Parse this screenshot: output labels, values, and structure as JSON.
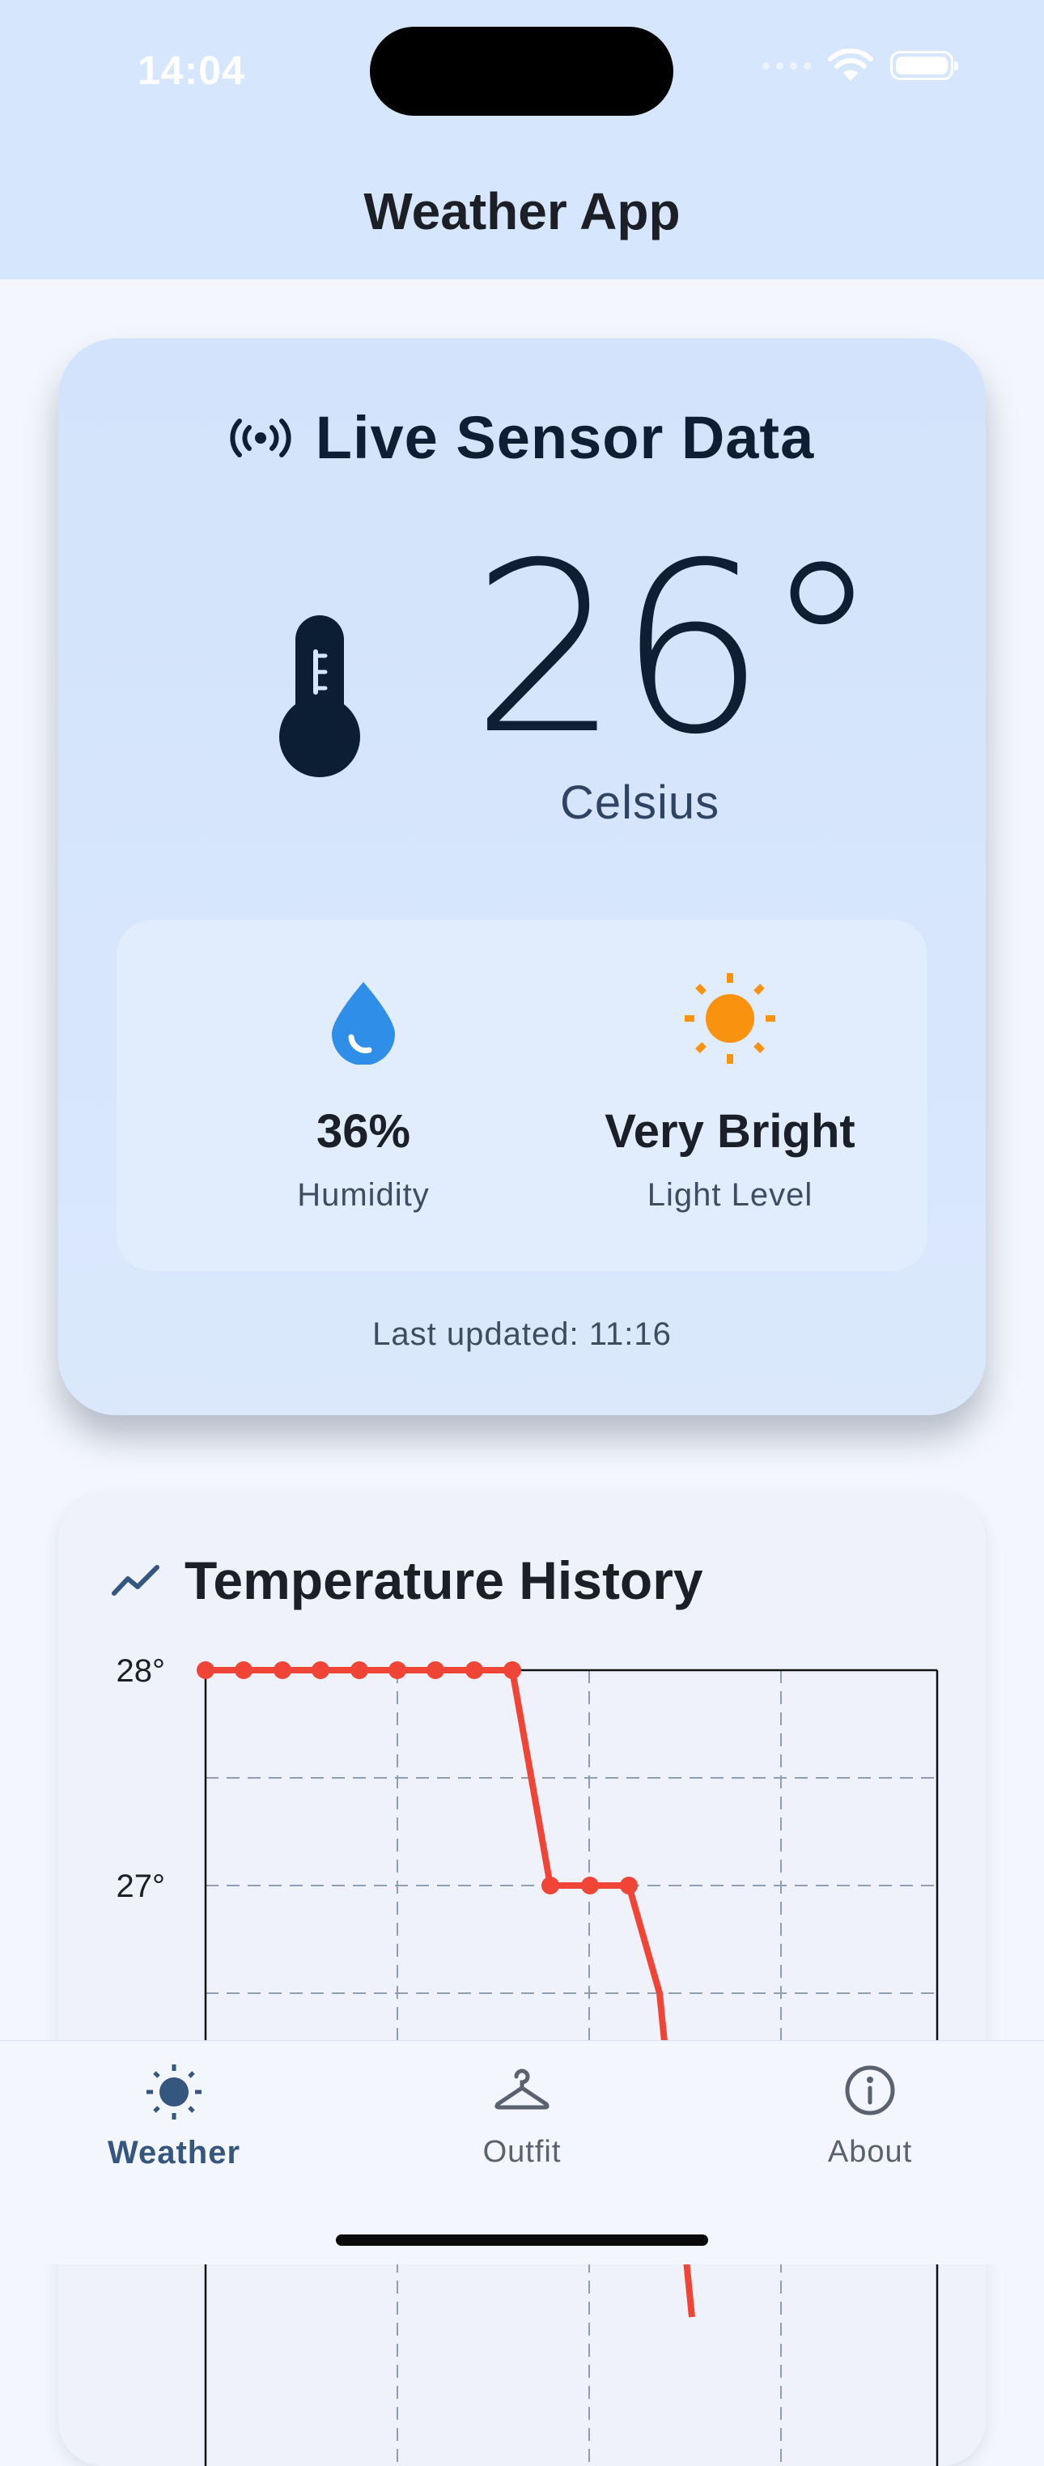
{
  "status_bar": {
    "time": "14:04"
  },
  "app": {
    "title": "Weather App"
  },
  "sensor": {
    "title": "Live Sensor Data",
    "temperature": "26°",
    "unit": "Celsius",
    "humidity": {
      "value": "36%",
      "label": "Humidity"
    },
    "light": {
      "value": "Very Bright",
      "label": "Light Level"
    },
    "last_updated": "Last updated: 11:16"
  },
  "history": {
    "title": "Temperature History"
  },
  "chart_data": {
    "type": "line",
    "title": "Temperature History",
    "y_tick_labels": [
      "28°",
      "27°"
    ],
    "ylim": [
      26.5,
      28
    ],
    "x": [
      0,
      1,
      2,
      3,
      4,
      5,
      6,
      7,
      8,
      9,
      10,
      11,
      12
    ],
    "values": [
      28,
      28,
      28,
      28,
      28,
      28,
      28,
      28,
      28,
      27,
      27,
      27,
      26.5
    ],
    "grid": true,
    "color": "#ef4436"
  },
  "nav": {
    "items": [
      {
        "label": "Weather",
        "active": true
      },
      {
        "label": "Outfit",
        "active": false
      },
      {
        "label": "About",
        "active": false
      }
    ]
  },
  "colors": {
    "accent": "#35577f",
    "sun": "#f9920f",
    "drop": "#2f8ee8",
    "line": "#ef4436"
  }
}
